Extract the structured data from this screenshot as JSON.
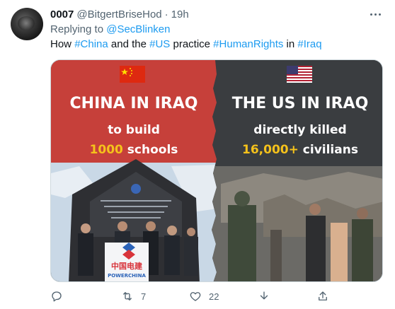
{
  "tweet": {
    "display_name": "0007",
    "handle": "@BitgertBriseHod",
    "separator": "·",
    "time": "19h",
    "replying_prefix": "Replying to ",
    "replying_to": "@SecBlinken",
    "text": {
      "t1": "How ",
      "h1": "#China",
      "t2": " and the ",
      "h2": "#US",
      "t3": " practice ",
      "h3": "#HumanRights",
      "t4": " in ",
      "h4": "#Iraq"
    }
  },
  "image": {
    "left_title": "CHINA IN IRAQ",
    "left_line1": "to build",
    "left_number": "1000",
    "left_rest": " schools",
    "right_title": "THE US IN IRAQ",
    "right_line1": "directly killed",
    "right_number": "16,000+",
    "right_rest": " civilians",
    "podium_brand_cn": "中国电建",
    "podium_brand_en": "POWERCHINA",
    "colors": {
      "left_bg": "#c6403a",
      "right_bg": "#3a3d40",
      "highlight": "#f5c21b"
    }
  },
  "actions": {
    "reply": {
      "icon": "reply-icon",
      "count": ""
    },
    "retweet": {
      "icon": "retweet-icon",
      "count": "7"
    },
    "like": {
      "icon": "heart-icon",
      "count": "22"
    },
    "download": {
      "icon": "download-icon",
      "count": ""
    },
    "share": {
      "icon": "share-icon",
      "count": ""
    }
  }
}
